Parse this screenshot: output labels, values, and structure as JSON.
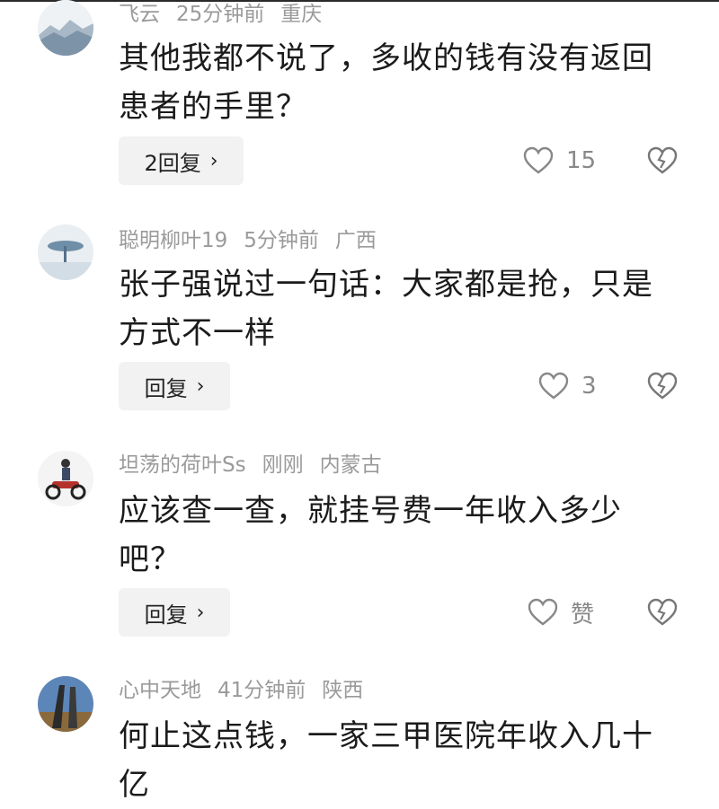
{
  "comments": [
    {
      "user": "飞云",
      "time": "25分钟前",
      "location": "重庆",
      "text": "其他我都不说了，多收的钱有没有返回患者的手里？",
      "reply_label": "2回复",
      "like_label": "15",
      "avatar_icon": "ink-landscape-avatar"
    },
    {
      "user": "聪明柳叶19",
      "time": "5分钟前",
      "location": "广西",
      "text": "张子强说过一句话：大家都是抢，只是方式不一样",
      "reply_label": "回复",
      "like_label": "3",
      "avatar_icon": "tree-landscape-avatar"
    },
    {
      "user": "坦荡的荷叶Ss",
      "time": "刚刚",
      "location": "内蒙古",
      "text": "应该查一查，就挂号费一年收入多少吧？",
      "reply_label": "回复",
      "like_label": "赞",
      "avatar_icon": "motorcycle-rider-avatar"
    },
    {
      "user": "心中天地",
      "time": "41分钟前",
      "location": "陕西",
      "text": "何止这点钱，一家三甲医院年收入几十亿",
      "avatar_icon": "sky-sculpture-avatar"
    }
  ],
  "ui": {
    "chevron": "›"
  },
  "colors": {
    "meta": "#9a9a9a",
    "text": "#1b1b1b",
    "button_bg": "#f2f2f2",
    "icon": "#888888"
  }
}
